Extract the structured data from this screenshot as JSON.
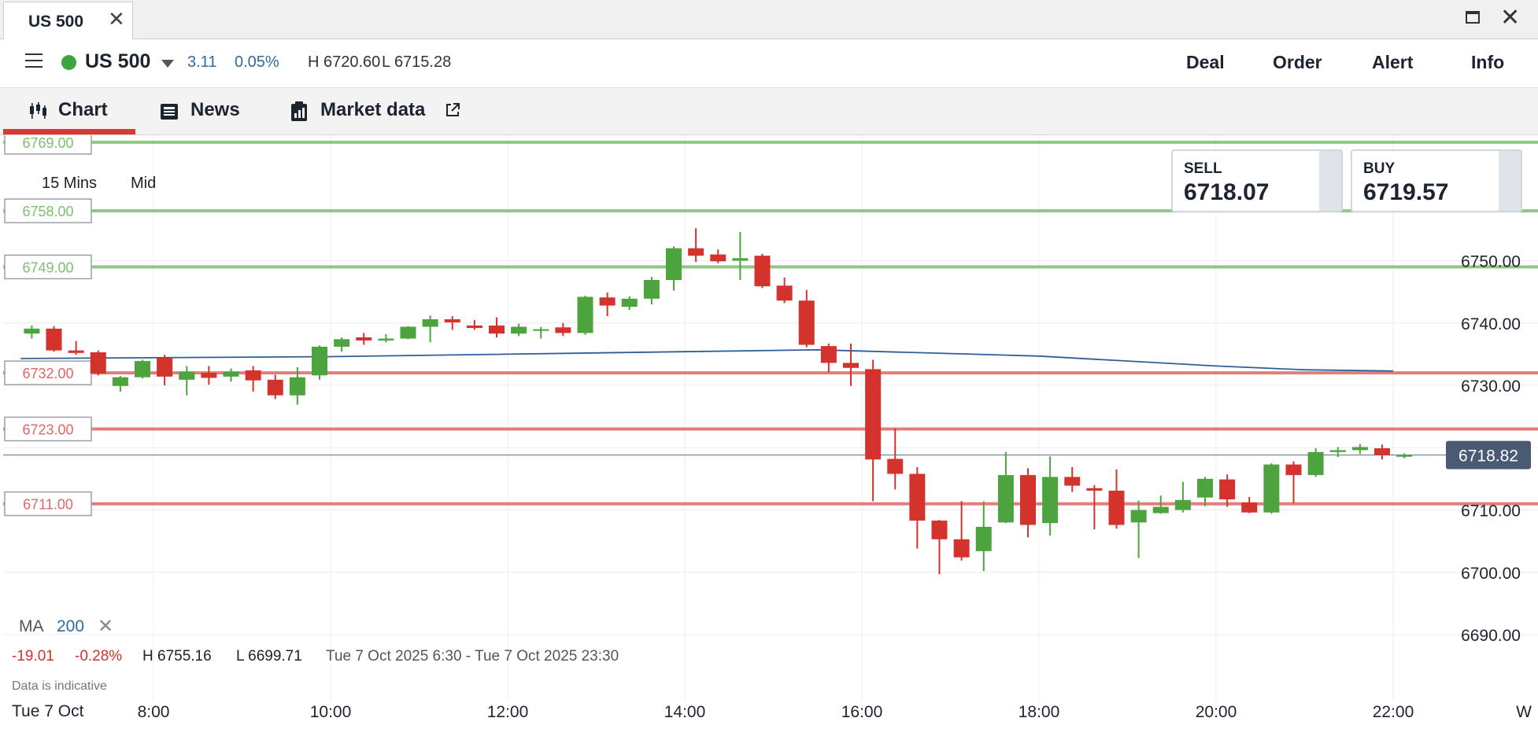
{
  "tab": {
    "title": "US 500",
    "close_icon": "close-icon"
  },
  "window": {
    "maximize_icon": "maximize-icon",
    "close_icon": "close-icon"
  },
  "header": {
    "instrument": "US 500",
    "status_color": "#3aa640",
    "change": "3.11",
    "change_pct": "0.05%",
    "high": "H 6720.60",
    "low": "L 6715.28",
    "actions": [
      "Deal",
      "Order",
      "Alert",
      "Info"
    ]
  },
  "subtabs": {
    "chart": "Chart",
    "news": "News",
    "market_data": "Market data"
  },
  "chart_controls": {
    "timeframe": "15 Mins",
    "price_type": "Mid"
  },
  "quotes": {
    "sell_label": "SELL",
    "sell_price": "6718.07",
    "buy_label": "BUY",
    "buy_price": "6719.57"
  },
  "indicator": {
    "name": "MA",
    "period": "200"
  },
  "stats": {
    "change": "-19.01",
    "change_pct": "-0.28%",
    "high": "H 6755.16",
    "low": "L 6699.71",
    "range": "Tue 7 Oct 2025 6:30 - Tue 7 Oct 2025 23:30"
  },
  "disclaimer": "Data is indicative",
  "bottom_date": "Tue 7 Oct",
  "chart_data": {
    "type": "candlestick",
    "title": "",
    "xlabel": "",
    "ylabel": "",
    "ylim": [
      6680,
      6770
    ],
    "xlim": [
      "6:30",
      "23:30"
    ],
    "y_ticks": [
      6690,
      6700,
      6710,
      6720,
      6730,
      6740,
      6750
    ],
    "y_tick_labels": [
      "6690.00",
      "6700.00",
      "6710.00",
      "",
      "6730.00",
      "6740.00",
      "6750.00"
    ],
    "x_ticks": [
      "8:00",
      "10:00",
      "12:00",
      "14:00",
      "16:00",
      "18:00",
      "20:00",
      "22:00"
    ],
    "x_tick_labels": [
      "8:00",
      "10:00",
      "12:00",
      "14:00",
      "16:00",
      "18:00",
      "20:00",
      "22:00"
    ],
    "x_trailing_label": "W",
    "grid": true,
    "up_color": "#4da33d",
    "down_color": "#d4322c",
    "current_price": {
      "value": 6718.82,
      "label": "6718.82"
    },
    "levels": [
      {
        "value": 6769,
        "label": "6769.00",
        "color": "#7dbf6e"
      },
      {
        "value": 6758,
        "label": "6758.00",
        "color": "#7dbf6e"
      },
      {
        "value": 6749,
        "label": "6749.00",
        "color": "#7dbf6e"
      },
      {
        "value": 6732,
        "label": "6732.00",
        "color": "#e06666"
      },
      {
        "value": 6723,
        "label": "6723.00",
        "color": "#e06666"
      },
      {
        "value": 6711,
        "label": "6711.00",
        "color": "#e06666"
      }
    ],
    "ma": {
      "name": "MA 200",
      "color": "#2f5f99",
      "points": [
        [
          "6:30",
          6734.3
        ],
        [
          "10:00",
          6734.6
        ],
        [
          "14:00",
          6735.4
        ],
        [
          "15:30",
          6735.7
        ],
        [
          "18:00",
          6734.7
        ],
        [
          "20:00",
          6733.1
        ],
        [
          "21:00",
          6732.5
        ],
        [
          "22:00",
          6732.3
        ]
      ]
    },
    "candles": [
      {
        "t": "6:45",
        "o": 6738.3,
        "h": 6739.6,
        "l": 6737.5,
        "c": 6739.1
      },
      {
        "t": "7:00",
        "o": 6739.1,
        "h": 6739.5,
        "l": 6735.4,
        "c": 6735.6
      },
      {
        "t": "7:15",
        "o": 6735.6,
        "h": 6737.1,
        "l": 6734.9,
        "c": 6735.2
      },
      {
        "t": "7:30",
        "o": 6735.3,
        "h": 6735.6,
        "l": 6731.6,
        "c": 6731.9
      },
      {
        "t": "7:45",
        "o": 6729.9,
        "h": 6731.5,
        "l": 6729.0,
        "c": 6731.3
      },
      {
        "t": "8:00",
        "o": 6731.3,
        "h": 6734.1,
        "l": 6731.1,
        "c": 6733.9
      },
      {
        "t": "8:15",
        "o": 6734.4,
        "h": 6734.9,
        "l": 6730.0,
        "c": 6731.4
      },
      {
        "t": "8:30",
        "o": 6730.9,
        "h": 6733.1,
        "l": 6728.4,
        "c": 6732.2
      },
      {
        "t": "8:45",
        "o": 6732.0,
        "h": 6733.1,
        "l": 6730.1,
        "c": 6731.2
      },
      {
        "t": "9:00",
        "o": 6731.4,
        "h": 6732.7,
        "l": 6730.6,
        "c": 6732.2
      },
      {
        "t": "9:15",
        "o": 6732.4,
        "h": 6733.1,
        "l": 6729.0,
        "c": 6730.8
      },
      {
        "t": "9:30",
        "o": 6730.9,
        "h": 6731.7,
        "l": 6727.8,
        "c": 6728.4
      },
      {
        "t": "9:45",
        "o": 6728.4,
        "h": 6732.9,
        "l": 6726.9,
        "c": 6731.3
      },
      {
        "t": "10:00",
        "o": 6731.6,
        "h": 6736.4,
        "l": 6730.9,
        "c": 6736.2
      },
      {
        "t": "10:15",
        "o": 6736.2,
        "h": 6737.7,
        "l": 6735.4,
        "c": 6737.4
      },
      {
        "t": "10:30",
        "o": 6737.7,
        "h": 6738.4,
        "l": 6736.5,
        "c": 6737.2
      },
      {
        "t": "10:45",
        "o": 6737.2,
        "h": 6738.2,
        "l": 6736.9,
        "c": 6737.5
      },
      {
        "t": "11:00",
        "o": 6737.5,
        "h": 6739.5,
        "l": 6737.4,
        "c": 6739.4
      },
      {
        "t": "11:15",
        "o": 6739.4,
        "h": 6741.2,
        "l": 6736.9,
        "c": 6740.6
      },
      {
        "t": "11:30",
        "o": 6740.6,
        "h": 6741.1,
        "l": 6738.9,
        "c": 6740.1
      },
      {
        "t": "11:45",
        "o": 6739.6,
        "h": 6740.5,
        "l": 6738.9,
        "c": 6739.2
      },
      {
        "t": "12:00",
        "o": 6739.6,
        "h": 6740.9,
        "l": 6737.7,
        "c": 6738.3
      },
      {
        "t": "12:15",
        "o": 6738.3,
        "h": 6739.9,
        "l": 6737.9,
        "c": 6739.4
      },
      {
        "t": "12:30",
        "o": 6738.9,
        "h": 6739.4,
        "l": 6737.5,
        "c": 6739.0
      },
      {
        "t": "12:45",
        "o": 6739.3,
        "h": 6740.0,
        "l": 6737.9,
        "c": 6738.4
      },
      {
        "t": "13:00",
        "o": 6738.4,
        "h": 6744.4,
        "l": 6738.1,
        "c": 6744.2
      },
      {
        "t": "13:15",
        "o": 6744.1,
        "h": 6744.9,
        "l": 6741.1,
        "c": 6742.8
      },
      {
        "t": "13:30",
        "o": 6742.6,
        "h": 6744.3,
        "l": 6742.1,
        "c": 6743.9
      },
      {
        "t": "13:45",
        "o": 6743.9,
        "h": 6747.4,
        "l": 6743.0,
        "c": 6746.9
      },
      {
        "t": "14:00",
        "o": 6746.9,
        "h": 6752.3,
        "l": 6745.2,
        "c": 6752.0
      },
      {
        "t": "14:15",
        "o": 6752.0,
        "h": 6755.2,
        "l": 6749.8,
        "c": 6750.8
      },
      {
        "t": "14:30",
        "o": 6751.0,
        "h": 6751.8,
        "l": 6749.6,
        "c": 6749.9
      },
      {
        "t": "14:45",
        "o": 6750.0,
        "h": 6754.6,
        "l": 6746.9,
        "c": 6750.4
      },
      {
        "t": "15:00",
        "o": 6750.8,
        "h": 6751.1,
        "l": 6745.6,
        "c": 6745.9
      },
      {
        "t": "15:15",
        "o": 6746.0,
        "h": 6747.3,
        "l": 6743.2,
        "c": 6743.6
      },
      {
        "t": "15:30",
        "o": 6743.6,
        "h": 6745.3,
        "l": 6736.1,
        "c": 6736.5
      },
      {
        "t": "15:45",
        "o": 6736.3,
        "h": 6736.7,
        "l": 6732.1,
        "c": 6733.6
      },
      {
        "t": "16:00",
        "o": 6733.6,
        "h": 6736.7,
        "l": 6729.9,
        "c": 6732.8
      },
      {
        "t": "16:15",
        "o": 6732.6,
        "h": 6734.1,
        "l": 6711.4,
        "c": 6718.1
      },
      {
        "t": "16:30",
        "o": 6718.2,
        "h": 6723.1,
        "l": 6713.3,
        "c": 6715.8
      },
      {
        "t": "16:45",
        "o": 6715.8,
        "h": 6716.9,
        "l": 6703.8,
        "c": 6708.3
      },
      {
        "t": "17:00",
        "o": 6708.3,
        "h": 6708.4,
        "l": 6699.7,
        "c": 6705.3
      },
      {
        "t": "17:15",
        "o": 6705.3,
        "h": 6711.4,
        "l": 6701.9,
        "c": 6702.4
      },
      {
        "t": "17:30",
        "o": 6703.4,
        "h": 6711.4,
        "l": 6700.2,
        "c": 6707.3
      },
      {
        "t": "17:45",
        "o": 6708.0,
        "h": 6719.3,
        "l": 6707.9,
        "c": 6715.6
      },
      {
        "t": "18:00",
        "o": 6715.6,
        "h": 6716.7,
        "l": 6705.6,
        "c": 6707.6
      },
      {
        "t": "18:15",
        "o": 6707.9,
        "h": 6718.6,
        "l": 6705.9,
        "c": 6715.3
      },
      {
        "t": "18:30",
        "o": 6715.3,
        "h": 6716.9,
        "l": 6712.9,
        "c": 6713.9
      },
      {
        "t": "18:45",
        "o": 6713.5,
        "h": 6714.0,
        "l": 6706.9,
        "c": 6713.1
      },
      {
        "t": "19:00",
        "o": 6713.1,
        "h": 6716.5,
        "l": 6707.0,
        "c": 6707.6
      },
      {
        "t": "19:15",
        "o": 6708.0,
        "h": 6711.5,
        "l": 6702.3,
        "c": 6710.0
      },
      {
        "t": "19:30",
        "o": 6709.5,
        "h": 6712.3,
        "l": 6709.4,
        "c": 6710.5
      },
      {
        "t": "19:45",
        "o": 6710.0,
        "h": 6714.5,
        "l": 6709.6,
        "c": 6711.6
      },
      {
        "t": "20:00",
        "o": 6712.0,
        "h": 6715.3,
        "l": 6710.6,
        "c": 6715.0
      },
      {
        "t": "20:15",
        "o": 6714.9,
        "h": 6715.7,
        "l": 6710.5,
        "c": 6711.7
      },
      {
        "t": "20:30",
        "o": 6711.2,
        "h": 6712.1,
        "l": 6709.5,
        "c": 6709.6
      },
      {
        "t": "20:45",
        "o": 6709.6,
        "h": 6717.5,
        "l": 6709.4,
        "c": 6717.3
      },
      {
        "t": "21:00",
        "o": 6717.3,
        "h": 6717.8,
        "l": 6711.1,
        "c": 6715.6
      },
      {
        "t": "21:15",
        "o": 6715.6,
        "h": 6719.9,
        "l": 6715.3,
        "c": 6719.3
      },
      {
        "t": "21:30",
        "o": 6719.3,
        "h": 6720.1,
        "l": 6718.5,
        "c": 6719.6
      },
      {
        "t": "21:45",
        "o": 6719.6,
        "h": 6720.6,
        "l": 6719.0,
        "c": 6720.1
      },
      {
        "t": "22:00",
        "o": 6719.9,
        "h": 6720.5,
        "l": 6718.1,
        "c": 6718.8
      },
      {
        "t": "22:15",
        "o": 6718.6,
        "h": 6719.1,
        "l": 6718.3,
        "c": 6718.8
      }
    ]
  }
}
